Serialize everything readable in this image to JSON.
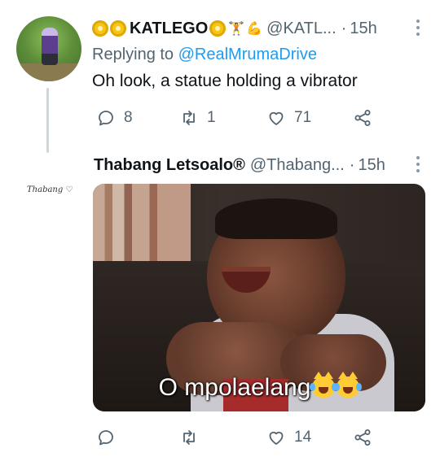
{
  "tweet1": {
    "display_name": "KATLEGO",
    "emoji_prefix": [
      "coin-icon",
      "coin-icon"
    ],
    "emoji_suffix": [
      "coin-icon",
      "weightlifter-icon",
      "flexed-biceps-icon"
    ],
    "handle": "@KATL...",
    "separator": "·",
    "time": "15h",
    "replying_prefix": "Replying to",
    "replying_mention": "@RealMrumaDrive",
    "text": "Oh look, a statue holding a vibrator",
    "stats": {
      "replies": "8",
      "retweets": "1",
      "likes": "71"
    }
  },
  "tweet2": {
    "display_name": "Thabang Letsoalo®",
    "handle": "@Thabang...",
    "separator": "·",
    "time": "15h",
    "avatar_text": "Thabang ♡",
    "media_caption": "O mpolaelang",
    "caption_emoji": [
      "crying-laughing-cat-icon",
      "crying-laughing-cat-icon"
    ],
    "stats": {
      "replies": "",
      "retweets": "",
      "likes": "14"
    }
  },
  "colors": {
    "text_primary": "#0f1419",
    "text_secondary": "#536471",
    "link": "#1d9bf0",
    "thread_line": "#ccd6dd"
  }
}
